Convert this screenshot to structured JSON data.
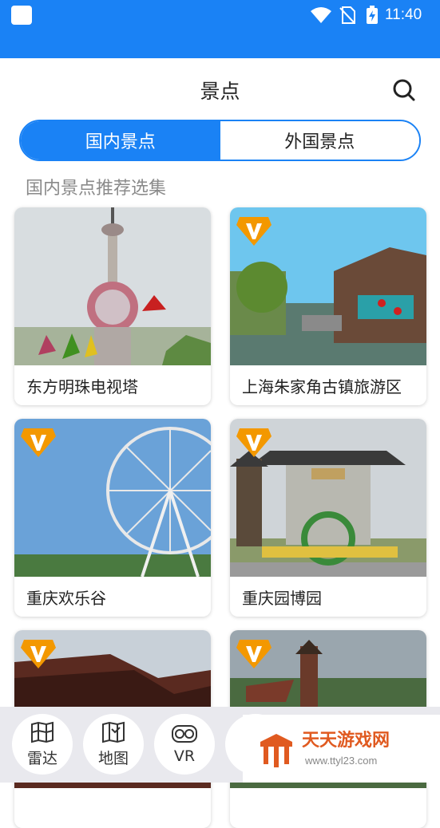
{
  "status_bar": {
    "time": "11:40"
  },
  "header": {
    "title": "景点"
  },
  "tabs": [
    {
      "label": "国内景点",
      "active": true
    },
    {
      "label": "外国景点",
      "active": false
    }
  ],
  "section_title": "国内景点推荐选集",
  "cards": [
    {
      "label": "东方明珠电视塔",
      "vip": false
    },
    {
      "label": "上海朱家角古镇旅游区",
      "vip": true
    },
    {
      "label": "重庆欢乐谷",
      "vip": true
    },
    {
      "label": "重庆园博园",
      "vip": true
    },
    {
      "label": "",
      "vip": true
    },
    {
      "label": "",
      "vip": true
    }
  ],
  "bottom_nav": [
    {
      "label": "雷达",
      "icon": "radar-icon"
    },
    {
      "label": "地图",
      "icon": "map-icon"
    },
    {
      "label": "VR",
      "icon": "vr-icon"
    }
  ],
  "watermark": {
    "name": "天天游戏网",
    "url": "www.ttyl23.com"
  },
  "colors": {
    "accent": "#1a82f5",
    "vip_badge": "#f39800"
  }
}
